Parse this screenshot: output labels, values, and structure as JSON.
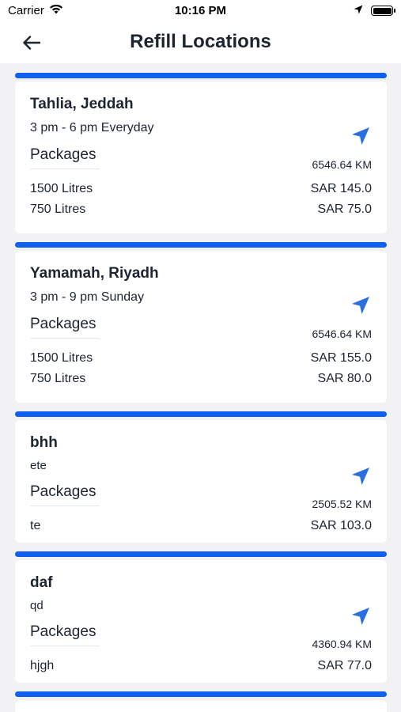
{
  "status": {
    "carrier": "Carrier",
    "time": "10:16 PM"
  },
  "header": {
    "title": "Refill Locations"
  },
  "locations": [
    {
      "name": "Tahlia, Jeddah",
      "hours": "3 pm - 6 pm Everyday",
      "packages_label": "Packages",
      "distance": "6546.64 KM",
      "packages": [
        {
          "name": "1500 Litres",
          "price": "SAR 145.0"
        },
        {
          "name": "750 Litres",
          "price": "SAR 75.0"
        }
      ]
    },
    {
      "name": "Yamamah, Riyadh",
      "hours": "3 pm - 9 pm Sunday",
      "packages_label": "Packages",
      "distance": "6546.64 KM",
      "packages": [
        {
          "name": "1500 Litres",
          "price": "SAR 155.0"
        },
        {
          "name": "750 Litres",
          "price": "SAR 80.0"
        }
      ]
    },
    {
      "name": "bhh",
      "hours": "ete",
      "packages_label": "Packages",
      "distance": "2505.52 KM",
      "packages": [
        {
          "name": "te",
          "price": "SAR 103.0"
        }
      ]
    },
    {
      "name": "daf",
      "hours": "qd",
      "packages_label": "Packages",
      "distance": "4360.94 KM",
      "packages": [
        {
          "name": "hjgh",
          "price": "SAR 77.0"
        }
      ]
    }
  ],
  "colors": {
    "accent": "#1060f0",
    "navigate_icon": "#2a6fe0",
    "background": "#f2f2f5"
  },
  "icons": {
    "back": "back-arrow-icon",
    "navigate": "navigation-arrow-icon",
    "wifi": "wifi-icon",
    "location": "location-services-icon",
    "battery": "battery-icon"
  }
}
